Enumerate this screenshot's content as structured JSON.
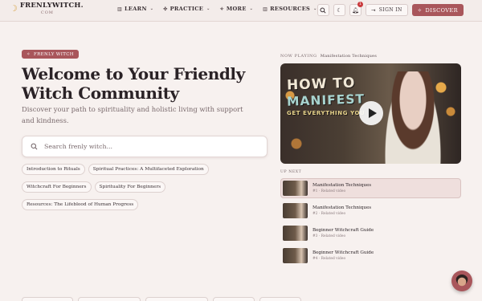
{
  "header": {
    "logo": {
      "name": "FRENLYWITCH.",
      "suffix": "COM",
      "icon": "crescent-moon-icon"
    },
    "nav": [
      {
        "label": "LEARN",
        "icon": "book-icon"
      },
      {
        "label": "PRACTICE",
        "icon": "sparkle-tools-icon"
      },
      {
        "label": "MORE",
        "icon": "sparkles-icon"
      },
      {
        "label": "RESOURCES",
        "icon": "library-icon"
      }
    ],
    "notification_count": "1",
    "signin_label": "SIGN IN",
    "discover_label": "DISCOVER"
  },
  "hero": {
    "tag": "FRENLY WITCH",
    "title": "Welcome to Your Friendly Witch Community",
    "subtitle": "Discover your path to spirituality and holistic living with support and kindness.",
    "search_placeholder": "Search frenly witch..."
  },
  "topics": [
    "Introduction to Rituals",
    "Spiritual Practices: A Multifaceted Exploration",
    "Witchcraft For Beginners",
    "Spirituality For Beginners",
    "Resources: The Lifeblood of Human Progress"
  ],
  "player": {
    "now_playing_label": "NOW PLAYING",
    "now_playing_title": "Manifestation Techniques",
    "thumb_line1": "HOW TO",
    "thumb_line2": "MANIFEST",
    "thumb_line3": "GET EVERYTHING YOU"
  },
  "up_next": {
    "label": "UP NEXT",
    "items": [
      {
        "title": "Manifestation Techniques",
        "meta": "#1 · Related video",
        "active": true
      },
      {
        "title": "Manifestation Techniques",
        "meta": "#2 · Related video",
        "active": false
      },
      {
        "title": "Beginner Witchcraft Guide",
        "meta": "#3 · Related video",
        "active": false
      },
      {
        "title": "Beginner Witchcraft Guide",
        "meta": "#4 · Related video",
        "active": false
      }
    ]
  },
  "colors": {
    "accent": "#a9565b",
    "background": "#f7f1ef",
    "text": "#2a2226"
  }
}
